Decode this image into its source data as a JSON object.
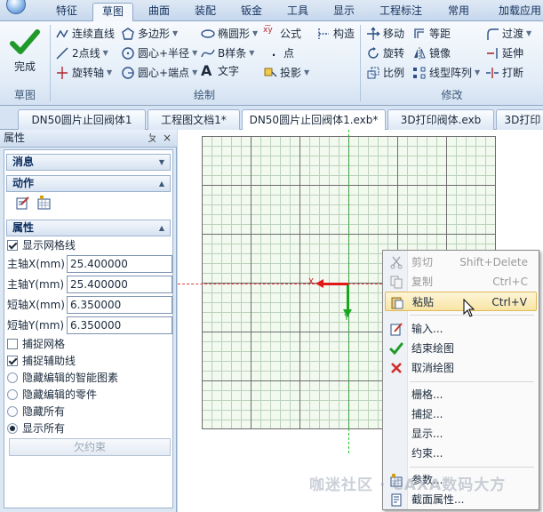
{
  "ribbon_tabs": [
    "特征",
    "草图",
    "曲面",
    "装配",
    "钣金",
    "工具",
    "显示",
    "工程标注",
    "常用",
    "加载应用"
  ],
  "active_tab": "草图",
  "ribbon": {
    "finish_label": "完成",
    "groups": {
      "sketch": "草图",
      "draw": "绘制",
      "modify": "修改"
    },
    "draw": {
      "line": "连续直线",
      "polygon": "多边形",
      "ellipse": "椭圆形",
      "formula": "公式",
      "construct": "构造",
      "two_point": "2点线",
      "center_radius": "圆心+半径",
      "bspline": "B样条",
      "point": "点",
      "rotate_axis": "旋转轴",
      "center_endpoint": "圆心+端点",
      "text": "文字",
      "project": "投影"
    },
    "modify": {
      "move": "移动",
      "offset": "等距",
      "fillet": "过渡",
      "rotate": "旋转",
      "mirror": "镜像",
      "extend": "延伸",
      "scale": "比例",
      "linear_array": "线型阵列",
      "break": "打断"
    }
  },
  "doc_tabs": [
    "DN50圆片止回阀体1",
    "工程图文档1*",
    "DN50圆片止回阀体1.exb*",
    "3D打印阀体.exb",
    "3D打印"
  ],
  "panel": {
    "title": "属性",
    "pin": "ㄆ",
    "close": "×",
    "sections": {
      "messages": "消息",
      "actions": "动作",
      "properties": "属性"
    },
    "show_grid": {
      "label": "显示网格线",
      "checked": true
    },
    "fields": [
      {
        "label": "主轴X(mm)",
        "value": "25.400000"
      },
      {
        "label": "主轴Y(mm)",
        "value": "25.400000"
      },
      {
        "label": "短轴X(mm)",
        "value": "6.350000"
      },
      {
        "label": "短轴Y(mm)",
        "value": "6.350000"
      }
    ],
    "snap_grid": {
      "label": "捕捉网格",
      "checked": false
    },
    "snap_guides": {
      "label": "捕捉辅助线",
      "checked": true
    },
    "radio_options": [
      {
        "label": "隐藏编辑的智能图素",
        "selected": false
      },
      {
        "label": "隐藏编辑的零件",
        "selected": false
      },
      {
        "label": "隐藏所有",
        "selected": false
      },
      {
        "label": "显示所有",
        "selected": true
      }
    ],
    "underconstrained": "欠约束"
  },
  "canvas": {
    "x_label": "X",
    "y_label": "Y"
  },
  "context_menu": [
    {
      "label": "剪切",
      "shortcut": "Shift+Delete",
      "icon": "scissors-icon",
      "disabled": true
    },
    {
      "label": "复制",
      "shortcut": "Ctrl+C",
      "icon": "copy-icon",
      "disabled": true
    },
    {
      "label": "粘贴",
      "shortcut": "Ctrl+V",
      "icon": "paste-icon",
      "disabled": false,
      "hover": true
    },
    {
      "label": "输入...",
      "shortcut": "",
      "icon": "input-icon"
    },
    {
      "label": "结束绘图",
      "shortcut": "",
      "icon": "checkmark-icon"
    },
    {
      "label": "取消绘图",
      "shortcut": "",
      "icon": "cancel-icon"
    },
    {
      "label": "栅格...",
      "shortcut": ""
    },
    {
      "label": "捕捉...",
      "shortcut": ""
    },
    {
      "label": "显示...",
      "shortcut": ""
    },
    {
      "label": "约束...",
      "shortcut": ""
    },
    {
      "label": "参数...",
      "shortcut": "",
      "icon": "parameters-icon"
    },
    {
      "label": "截面属性...",
      "shortcut": "",
      "icon": "section-props-icon"
    }
  ],
  "watermark": "咖迷社区 · CAXA数码大方",
  "colors": {
    "accent": "#1e4e8c",
    "x_axis": "#e21919",
    "y_axis": "#15a81b",
    "grid_bg": "#f2f9ef"
  }
}
